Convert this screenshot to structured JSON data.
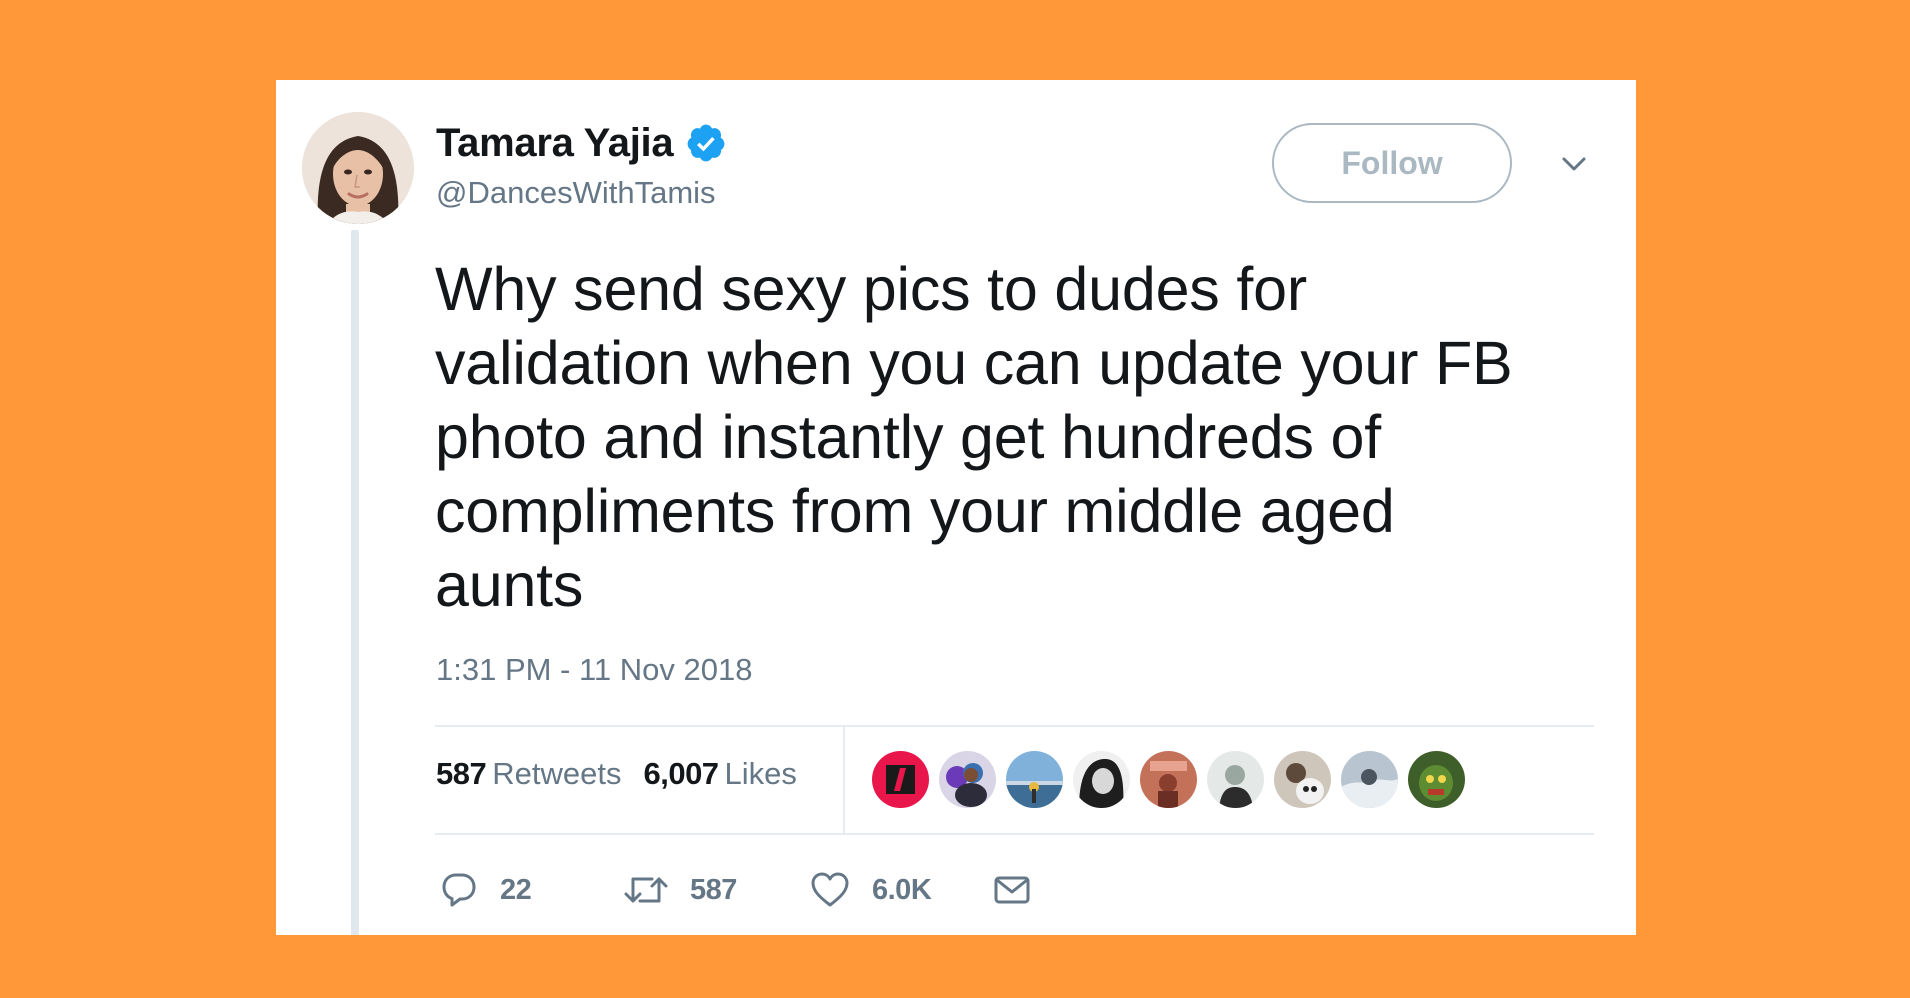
{
  "colors": {
    "background": "#FF9838",
    "card": "#FFFFFF",
    "text_primary": "#14171A",
    "text_secondary": "#657786",
    "verified_blue": "#1DA1F2",
    "follow_border": "#AAB8C2"
  },
  "author": {
    "display_name": "Tamara Yajia",
    "handle": "@DancesWithTamis",
    "verified": true,
    "avatar_icon": "profile-photo"
  },
  "header": {
    "follow_label": "Follow",
    "menu_icon": "chevron-down-icon"
  },
  "tweet": {
    "text": "Why send sexy pics to dudes for\nvalidation when you can update your FB\nphoto and instantly get hundreds of\ncompliments from your middle aged\naunts",
    "timestamp": "1:31 PM - 11 Nov 2018"
  },
  "stats": {
    "retweets_count": "587",
    "retweets_label": "Retweets",
    "likes_count": "6,007",
    "likes_label": "Likes"
  },
  "likers": [
    {
      "icon": "liker-avatar-1",
      "color": "#E8164B"
    },
    {
      "icon": "liker-avatar-2",
      "color": "#3A6FB0"
    },
    {
      "icon": "liker-avatar-3",
      "color": "#7FB1DA"
    },
    {
      "icon": "liker-avatar-4",
      "color": "#2B2B2B"
    },
    {
      "icon": "liker-avatar-5",
      "color": "#C4715A"
    },
    {
      "icon": "liker-avatar-6",
      "color": "#9AA7A0"
    },
    {
      "icon": "liker-avatar-7",
      "color": "#5E4A3A"
    },
    {
      "icon": "liker-avatar-8",
      "color": "#B8C4CF"
    },
    {
      "icon": "liker-avatar-9",
      "color": "#3F5F2A"
    }
  ],
  "actions": {
    "reply_count": "22",
    "retweet_count": "587",
    "like_count": "6.0K",
    "reply_icon": "reply-icon",
    "retweet_icon": "retweet-icon",
    "like_icon": "heart-icon",
    "dm_icon": "envelope-icon"
  }
}
